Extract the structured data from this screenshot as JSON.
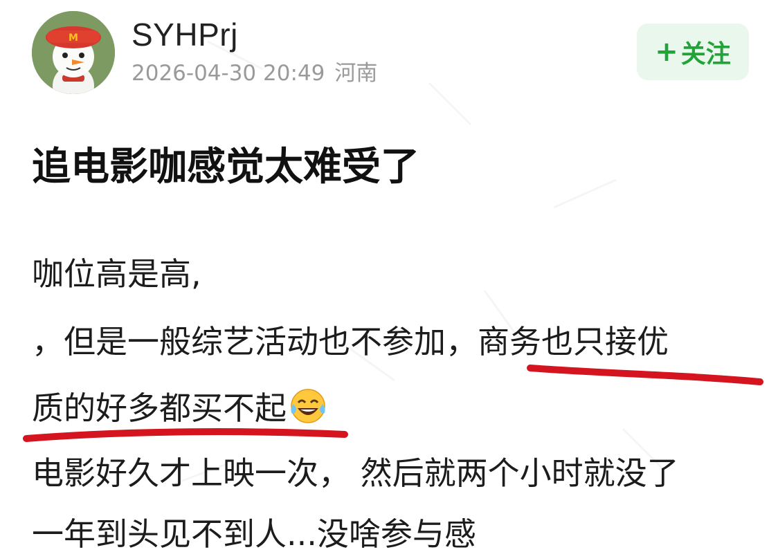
{
  "user": {
    "name": "SYHPrj",
    "timestamp": "2026-04-30 20:49",
    "location": "河南",
    "avatar_icon": "snowman-with-cap-avatar"
  },
  "follow_button": {
    "label": "关注",
    "icon": "plus-icon",
    "color": "#21a33a"
  },
  "post": {
    "title": "追电影咖感觉太难受了",
    "lines": [
      "咖位高是高,",
      "，但是一般综艺活动也不参加，",
      "商务也只接优",
      "质的好多都买不起",
      "电影好久才上映一次， 然后就两个小时就没了",
      "一年到头见不到人...没啥参与感"
    ],
    "emoji": "laughing-tears-emoji",
    "highlight_color": "#d4141e"
  }
}
